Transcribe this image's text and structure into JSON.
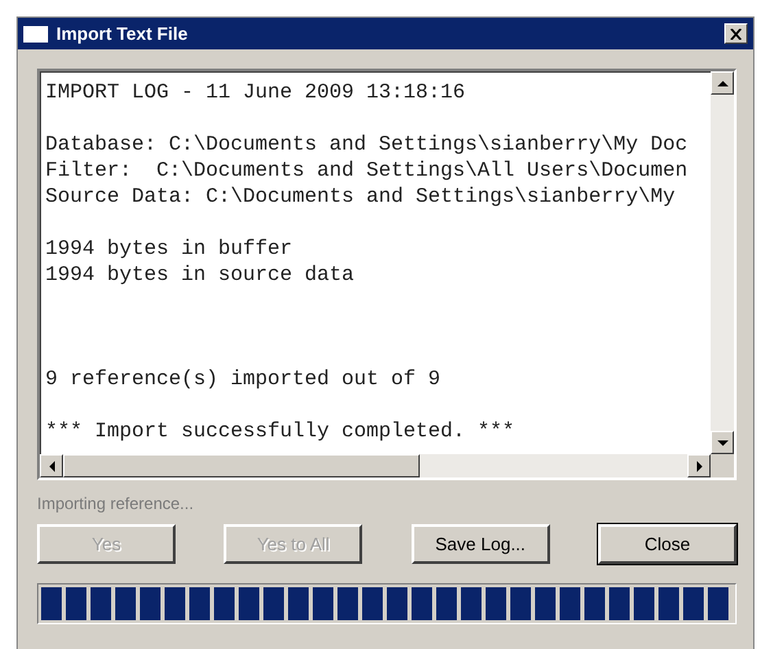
{
  "window": {
    "title": "Import Text File"
  },
  "log": {
    "blocks": [
      [
        "IMPORT LOG - 11 June 2009 13:18:16"
      ],
      [
        "Database: C:\\Documents and Settings\\sianberry\\My Doc",
        "Filter:  C:\\Documents and Settings\\All Users\\Documen",
        "Source Data: C:\\Documents and Settings\\sianberry\\My"
      ],
      [
        "1994 bytes in buffer",
        "1994 bytes in source data"
      ],
      [
        "9 reference(s) imported out of 9"
      ],
      [
        "*** Import successfully completed. ***"
      ]
    ]
  },
  "status": {
    "text": "Importing reference...",
    "disabled": true
  },
  "buttons": [
    {
      "label": "Yes",
      "disabled": true,
      "default": false
    },
    {
      "label": "Yes to All",
      "disabled": true,
      "default": false
    },
    {
      "label": "Save Log...",
      "disabled": false,
      "default": false
    },
    {
      "label": "Close",
      "disabled": false,
      "default": true
    }
  ],
  "progress": {
    "level": 1
  }
}
